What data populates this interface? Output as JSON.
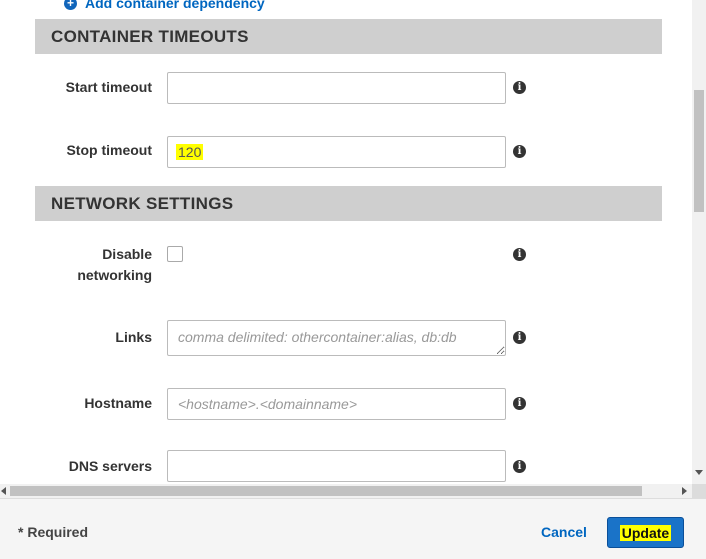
{
  "add_dependency_link": "Add container dependency",
  "sections": {
    "container_timeouts": {
      "title": "CONTAINER TIMEOUTS",
      "start_timeout_label": "Start timeout",
      "start_timeout_value": "",
      "stop_timeout_label": "Stop timeout",
      "stop_timeout_value": "120"
    },
    "network_settings": {
      "title": "NETWORK SETTINGS",
      "disable_networking_label_line1": "Disable",
      "disable_networking_label_line2": "networking",
      "disable_networking_checked": false,
      "links_label": "Links",
      "links_placeholder": "comma delimited: othercontainer:alias, db:db",
      "hostname_label": "Hostname",
      "hostname_placeholder": "<hostname>.<domainname>",
      "dns_servers_label": "DNS servers",
      "dns_servers_value": ""
    }
  },
  "icons": {
    "info": "i",
    "plus": "+"
  },
  "footer": {
    "required_note": "* Required",
    "cancel_label": "Cancel",
    "update_label": "Update"
  },
  "colors": {
    "section_header_bg": "#cfcfcf",
    "link_blue": "#0066c0",
    "primary_button": "#1a73c8",
    "highlight": "#ffff00"
  }
}
